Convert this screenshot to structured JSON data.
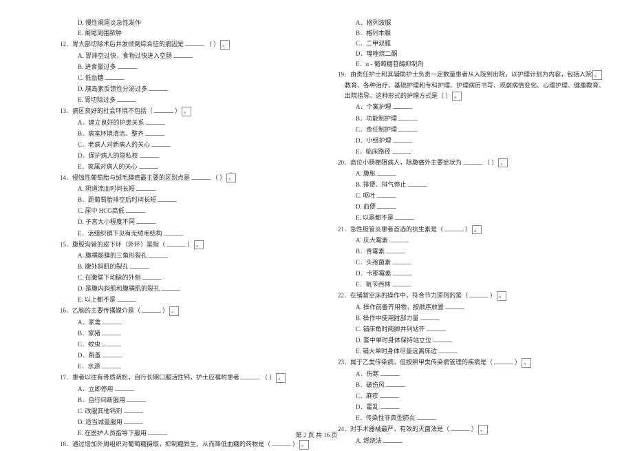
{
  "left": {
    "pre": [
      "D. 慢性阑尾炎急性发作",
      "E. 阑尾周围脓肿"
    ],
    "items": [
      {
        "num": "12",
        "text": "．胃大部切除术后并发倾倒综合征的病因是",
        "tail": "（      ）",
        "tailbox": "。",
        "opts": [
          "A. 胃排空过快，食物过快进入空肠",
          "B. 进食量过多",
          "C. 低血糖",
          "D. 胰岛素反馈性分泌过多",
          "E. 胃切除过多"
        ]
      },
      {
        "num": "13",
        "text": "．病区良好的社会环境不包括（",
        "tail": "）",
        "tailbox": "。",
        "opts": [
          "A．建立良好的护患关系",
          "B．病室环境清洁、整齐",
          "C．老病人对新病人的关心",
          "D．保护病人的隐私权",
          "E．家属对病人的关心"
        ]
      },
      {
        "num": "14",
        "text": "．侵蚀性葡萄胎与绒毛膜癌最主要的区别点是",
        "tail": "（      ）",
        "tailbox": "。",
        "opts": [
          "A. 阴道流血时间长短",
          "B．距葡萄胎排空后时间长短",
          "C. 尿中 HCG高低",
          "D. 子宫大小程度不同",
          "E．活组织镜下见有无绒毛结构"
        ]
      },
      {
        "num": "15",
        "text": "．腹股沟管的皮下环（外环）是指（",
        "tail": "）",
        "tailbox": "。",
        "opts": [
          "A. 腹横筋膜的三角形裂孔",
          "B. 腹外斜肌的裂孔",
          "C. 在腹壁下动脉的外侧",
          "D. 是腹内斜肌和腹横肌的裂孔",
          "E. 以上都不是"
        ]
      },
      {
        "num": "16",
        "text": "．乙脑的主要传播媒介是（",
        "tail": "）",
        "tailbox": "。",
        "opts": [
          "A．家禽",
          "B．家猪",
          "C．蚊虫",
          "D．跳蚤",
          "E．水源"
        ]
      },
      {
        "num": "17",
        "text": "．患者以往有骨质疏松，自行长期口服活性钙，护士应嘱咐患者",
        "tail": "（      ）",
        "tailbox": "。",
        "opts": [
          "A．立即停用",
          "B．自行间断服用",
          "C. 改服其他钙剂",
          "D. 适当减量服用",
          "E. 在医护人员指导下服用"
        ]
      },
      {
        "num": "18",
        "text": "．通过增加外周组织对葡萄糖摄取，抑制糖异生，从而降低血糖的药物是（",
        "tail": "）",
        "tailbox": "。",
        "opts": []
      }
    ]
  },
  "right": {
    "pre": [
      "A．格列波脲",
      "B．格列本脲",
      "C．二甲双胍",
      "D．噻唑烷二酮",
      "E．α - 葡萄糖苷酶抑制剂"
    ],
    "items": [
      {
        "num": "19",
        "text": "．由责任护士和其辅助护士负责一定数量患者从入院到出院，以护理计划为内容，包括入院",
        "extra": [
          "教育、各种治疗、基础护理和专科护理、护理病历书写、观察病情变化、心理护理、健康教育、",
          "出院指导。这种形式的护理方式是（           ）"
        ],
        "tailbox": "。",
        "opts": [
          "A．个案护理",
          "B．功能制护理",
          "C．责任制护理",
          "D．小组护理",
          "E．临床路径"
        ]
      },
      {
        "num": "20",
        "text": "．高位小肠梗阻病人，除腹痛外主要症状为",
        "tail": "（     ）",
        "tailbox": "。",
        "opts": [
          "A. 腹胀",
          "B. 排便、排气停止",
          "C. 呕吐",
          "D. 血便",
          "E. 以是都不是"
        ]
      },
      {
        "num": "21",
        "text": "．急性胆管炎患者首选的抗生素是（",
        "tail": "）",
        "tailbox": "。",
        "opts": [
          "A. 庆大霉素",
          "B．青霉素",
          "C．头孢菌素",
          "D．卡那霉素",
          "E．氧苄西林"
        ]
      },
      {
        "num": "22",
        "text": "．在铺暂空床的操作中，符合节力原则的是（",
        "tail": "）",
        "tailbox": "。",
        "opts": [
          "A. 操作前备齐用物，按顺序放置",
          "B. 操作中使用肘部力量",
          "C. 铺床角时两脚并列站齐",
          "D. 套中单时身体保持站立位",
          "E. 铺大单时身体尽量远离床边"
        ]
      },
      {
        "num": "23",
        "text": "．属于乙类传染病，但按照甲类传染病管理的疾病是（",
        "tail": "）",
        "tailbox": "。",
        "opts": [
          "A．伤寒",
          "B．破伤风",
          "C．麻疹",
          "D．霍乱",
          "E．传染性非典型肺炎"
        ]
      },
      {
        "num": "24",
        "text": "．对手术器械最严，有效的灭菌法是（",
        "tail": "）",
        "tailbox": "。",
        "opts": [
          "A. 燃烧法"
        ]
      }
    ]
  },
  "footer": {
    "prefix": "第",
    "current": "2",
    "mid": "页 共",
    "total": "16",
    "suffix": "页"
  }
}
